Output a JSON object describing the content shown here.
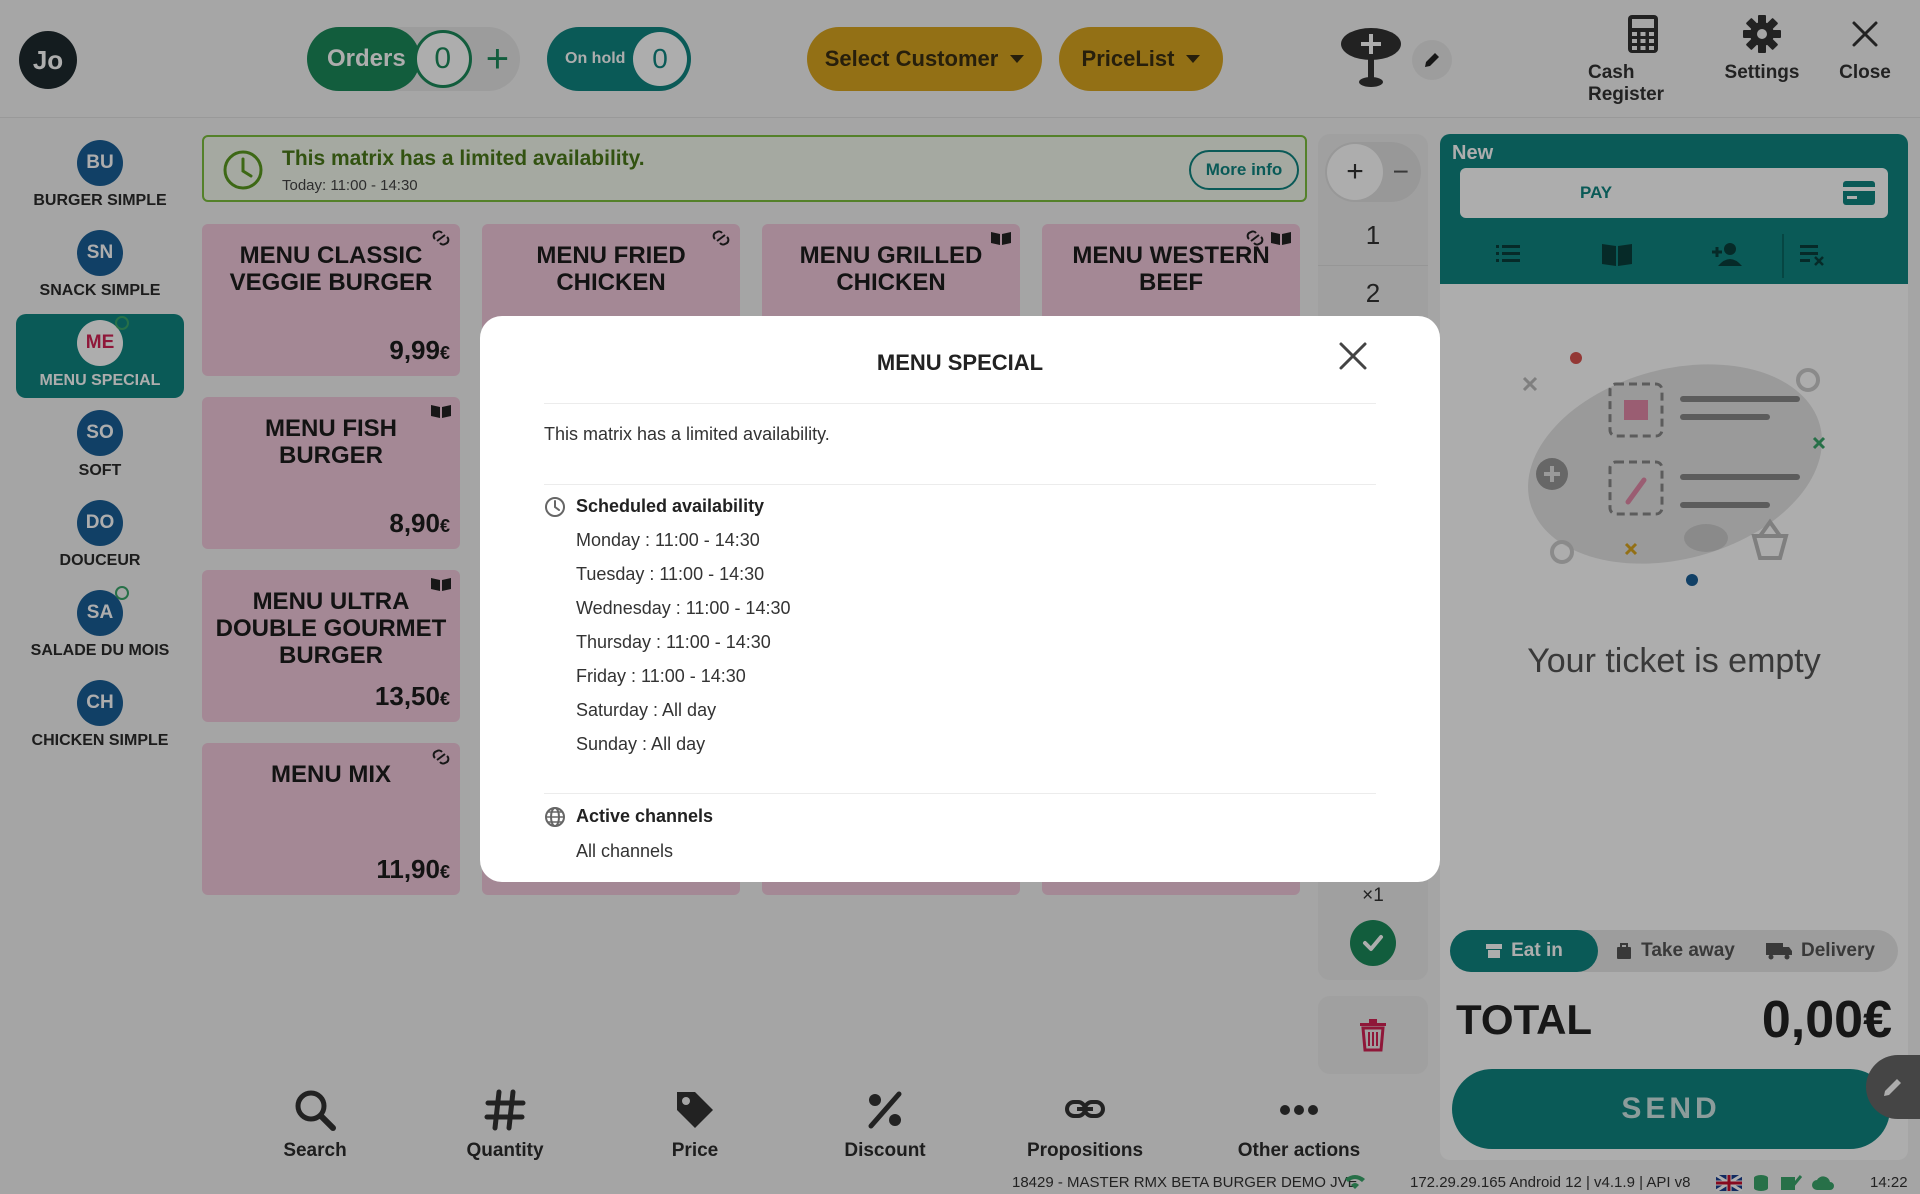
{
  "header": {
    "user_initials": "Jo",
    "orders_label": "Orders",
    "orders_count": "0",
    "onhold_label": "On hold",
    "onhold_count": "0",
    "select_customer": "Select Customer",
    "pricelist": "PriceList",
    "cash_register": "Cash Register",
    "settings": "Settings",
    "close": "Close"
  },
  "categories": [
    {
      "initials": "BU",
      "name": "BURGER SIMPLE"
    },
    {
      "initials": "SN",
      "name": "SNACK SIMPLE"
    },
    {
      "initials": "ME",
      "name": "MENU SPECIAL"
    },
    {
      "initials": "SO",
      "name": "SOFT"
    },
    {
      "initials": "DO",
      "name": "DOUCEUR"
    },
    {
      "initials": "SA",
      "name": "SALADE DU MOIS"
    },
    {
      "initials": "CH",
      "name": "CHICKEN SIMPLE"
    }
  ],
  "banner": {
    "title": "This matrix has a limited availability.",
    "subtitle": "Today: 11:00 - 14:30",
    "more_info": "More info"
  },
  "products": [
    {
      "name": "MENU CLASSIC VEGGIE BURGER",
      "price_main": "9,99",
      "price_cur": "€"
    },
    {
      "name": "MENU FRIED CHICKEN",
      "price_main": "",
      "price_cur": ""
    },
    {
      "name": "MENU GRILLED CHICKEN",
      "price_main": "",
      "price_cur": ""
    },
    {
      "name": "MENU WESTERN BEEF",
      "price_main": "",
      "price_cur": ""
    },
    {
      "name": "MENU FISH BURGER",
      "price_main": "8,90",
      "price_cur": "€"
    },
    {
      "name": "MENU ULTRA DOUBLE GOURMET BURGER",
      "price_main": "13,50",
      "price_cur": "€"
    },
    {
      "name": "MENU MIX",
      "price_main": "11,90",
      "price_cur": "€"
    }
  ],
  "quantity": {
    "rows": [
      "1",
      "2"
    ],
    "multiplier": "×1"
  },
  "ticket": {
    "status": "New",
    "pay": "PAY",
    "empty": "Your ticket is empty",
    "modes": [
      "Eat in",
      "Take away",
      "Delivery"
    ],
    "total_label": "TOTAL",
    "total_value": "0,00€",
    "send": "SEND"
  },
  "toolbar": [
    "Search",
    "Quantity",
    "Price",
    "Discount",
    "Propositions",
    "Other actions"
  ],
  "statusbar": {
    "store": "18429 - MASTER RMX BETA BURGER DEMO JVE",
    "system": "172.29.29.165 Android 12 | v4.1.9 | API v8",
    "time": "14:22"
  },
  "modal": {
    "title": "MENU SPECIAL",
    "description": "This matrix has a limited availability.",
    "schedule_title": "Scheduled availability",
    "schedule": [
      "Monday : 11:00 - 14:30",
      "Tuesday : 11:00 - 14:30",
      "Wednesday : 11:00 - 14:30",
      "Thursday : 11:00 - 14:30",
      "Friday : 11:00 - 14:30",
      "Saturday : All day",
      "Sunday : All day"
    ],
    "channels_title": "Active channels",
    "channels": "All channels"
  },
  "colors": {
    "teal": "#0f8580",
    "green": "#1b8a5a",
    "gold": "#d9a520",
    "pink_tile": "#f2c9dc",
    "category_blue": "#1a5f97",
    "availability_green": "#7cbf3e"
  }
}
